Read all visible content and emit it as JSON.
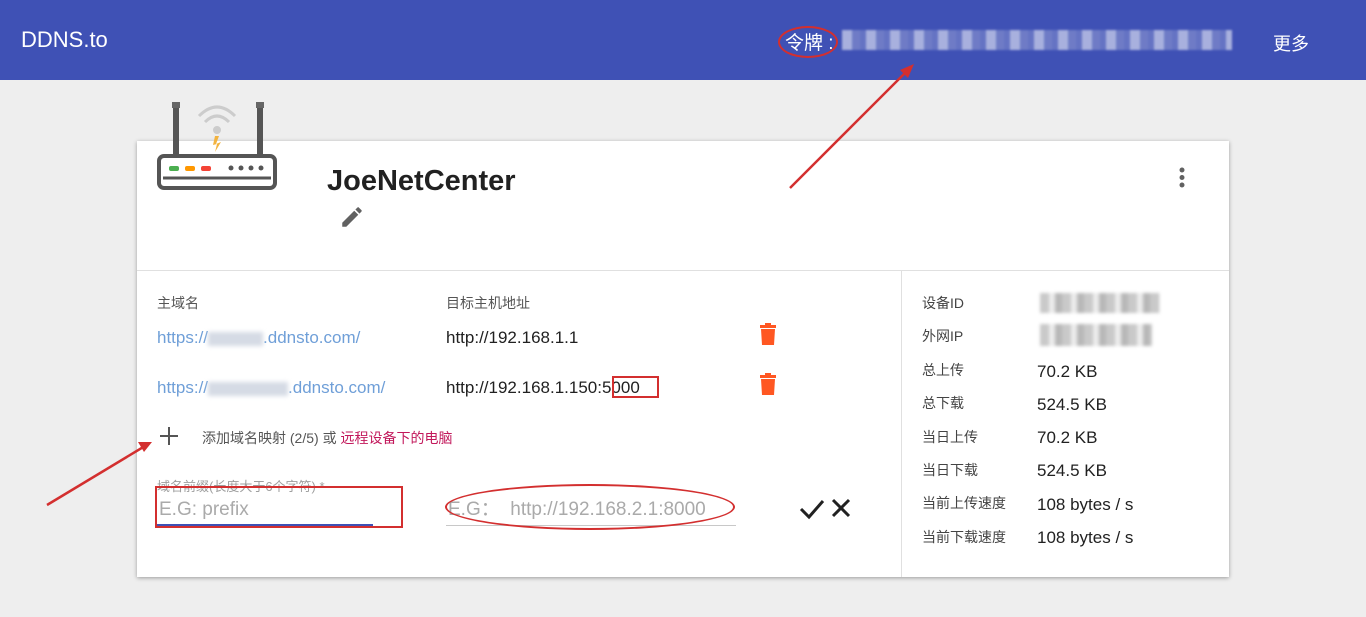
{
  "header": {
    "brand": "DDNS.to",
    "token_label": "令牌 :",
    "more_label": "更多"
  },
  "device": {
    "name": "JoeNetCenter"
  },
  "table": {
    "col_domain": "主域名",
    "col_target": "目标主机地址",
    "rows": [
      {
        "domain_prefix": "https://",
        "domain_suffix": ".ddnsto.com/",
        "target": "http://192.168.1.1"
      },
      {
        "domain_prefix": "https://",
        "domain_suffix": ".ddnsto.com/",
        "target_main": "http://192.168.1.150:",
        "target_port": "5000"
      }
    ]
  },
  "add_mapping": {
    "text": "添加域名映射 (2/5) 或 ",
    "link": "远程设备下的电脑"
  },
  "form": {
    "prefix_label": "域名前缀(长度大于6个字符) *",
    "prefix_placeholder": "E.G: prefix",
    "target_placeholder": "E.G：  http://192.168.2.1:8000"
  },
  "stats": [
    {
      "label": "设备ID",
      "value": null
    },
    {
      "label": "外网IP",
      "value": null
    },
    {
      "label": "总上传",
      "value": "70.2 KB"
    },
    {
      "label": "总下载",
      "value": "524.5 KB"
    },
    {
      "label": "当日上传",
      "value": "70.2 KB"
    },
    {
      "label": "当日下载",
      "value": "524.5 KB"
    },
    {
      "label": "当前上传速度",
      "value": "108 bytes / s"
    },
    {
      "label": "当前下载速度",
      "value": "108 bytes / s"
    }
  ],
  "colors": {
    "app_bar": "#3f51b5",
    "link": "#6f9fd8",
    "accent_link": "#c2185b",
    "delete": "#ff5722",
    "annotation": "#d32f2f"
  }
}
